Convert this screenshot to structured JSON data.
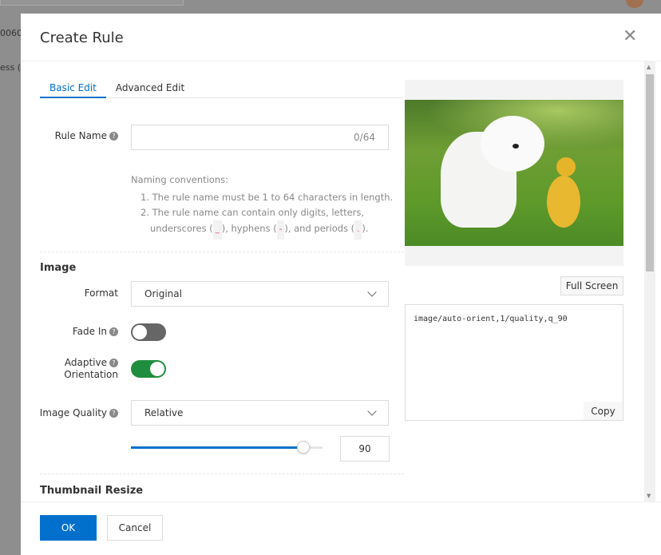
{
  "background": {
    "partial_text_1": "0060",
    "partial_text_2": "ess ("
  },
  "dialog": {
    "title": "Create Rule",
    "close_icon": "close-icon"
  },
  "tabs": [
    {
      "label": "Basic Edit",
      "active": true
    },
    {
      "label": "Advanced Edit",
      "active": false
    }
  ],
  "rule_name": {
    "label": "Rule Name",
    "value": "",
    "counter": "0/64",
    "help_title": "Naming conventions:",
    "help_1": "1. The rule name must be 1 to 64 characters in length.",
    "help_2a": "2. The rule name can contain only digits, letters,",
    "help_2b_underscores": "underscores (",
    "help_code_underscore": "_",
    "help_2b_hyphens": "), hyphens (",
    "help_code_hyphen": "-",
    "help_2b_periods": "), and periods (",
    "help_code_period": ".",
    "help_2b_end": ")."
  },
  "image_section": {
    "title": "Image",
    "format": {
      "label": "Format",
      "value": "Original"
    },
    "fade_in": {
      "label": "Fade In",
      "on": false
    },
    "adaptive": {
      "label1": "Adaptive",
      "label2": "Orientation",
      "on": true
    },
    "quality": {
      "label": "Image Quality",
      "value": "Relative",
      "slider_value": 90,
      "slider_max": 100,
      "input_value": "90"
    }
  },
  "thumbnail_section": {
    "title": "Thumbnail Resize"
  },
  "preview": {
    "full_screen": "Full Screen",
    "code": "image/auto-orient,1/quality,q_90",
    "copy": "Copy"
  },
  "footer": {
    "ok": "OK",
    "cancel": "Cancel"
  },
  "colors": {
    "accent": "#0070cc",
    "toggle_on": "#1e8e3e",
    "toggle_off": "#666666"
  }
}
